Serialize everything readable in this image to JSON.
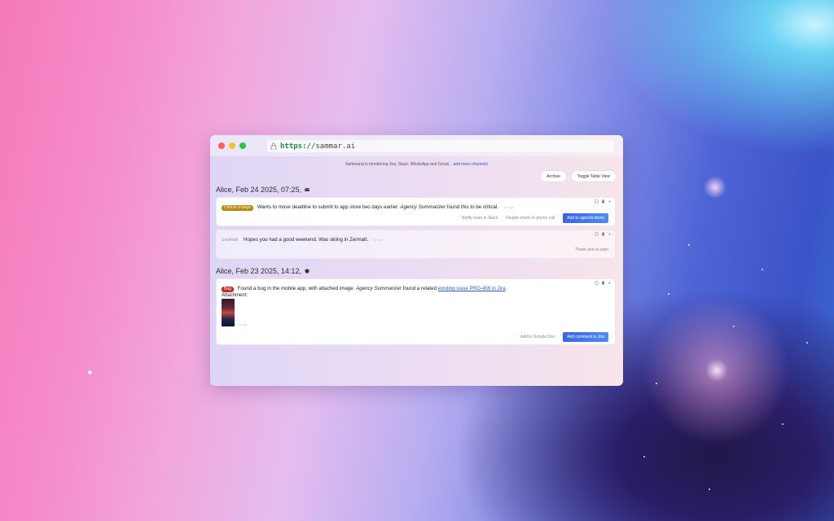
{
  "browser": {
    "url_scheme": "https://",
    "url_host": "sammar.ai"
  },
  "monitor": {
    "text": "Sammarai is monitoring Jira, Slack, WhatsApp and Gmail...",
    "link": "add more channels"
  },
  "toolbar": {
    "archive_label": "Archive",
    "toggle_table_label": "Toggle Table View"
  },
  "groups": [
    {
      "header": "Alice, Feb 24 2025, 07:25,",
      "icon": "mail-icon",
      "cards": [
        {
          "badge": "Critical change",
          "text_before": "Wants to move deadline to submit to app store two days earlier.",
          "agent": "Agency Summarizer",
          "text_after": "found this to be critical.",
          "timestamp": "2m ago",
          "actions": [
            "Notify team in Slack",
            "Double-check in phone call"
          ],
          "primary": "Add to agenda items"
        },
        {
          "badge": "Smalltalk",
          "text": "Hopes you had a good weekend. Was skiing in Zermatt.",
          "timestamp": "2m ago",
          "actions": [
            "Thank and re-wish"
          ]
        }
      ]
    },
    {
      "header": "Alice, Feb 23 2025, 14:12,",
      "icon": "jira-icon",
      "cards": [
        {
          "badge": "Bug",
          "text_before": "Found a bug in the mobile app, with attached image.",
          "agent": "Agency Summarizer",
          "text_middle": "found a related",
          "link": "existing issue PRO-456 in Jira",
          "text_after": ".",
          "attachment_label": "Attachment:",
          "timestamp": "2m ago",
          "actions": [
            "Add to Google Doc"
          ],
          "primary": "Add comment to Jira"
        }
      ]
    }
  ],
  "colors": {
    "accent": "#3b63e6",
    "critical_badge": "#b38a16",
    "bug_badge": "#c62828",
    "link": "#2f5bd8"
  }
}
